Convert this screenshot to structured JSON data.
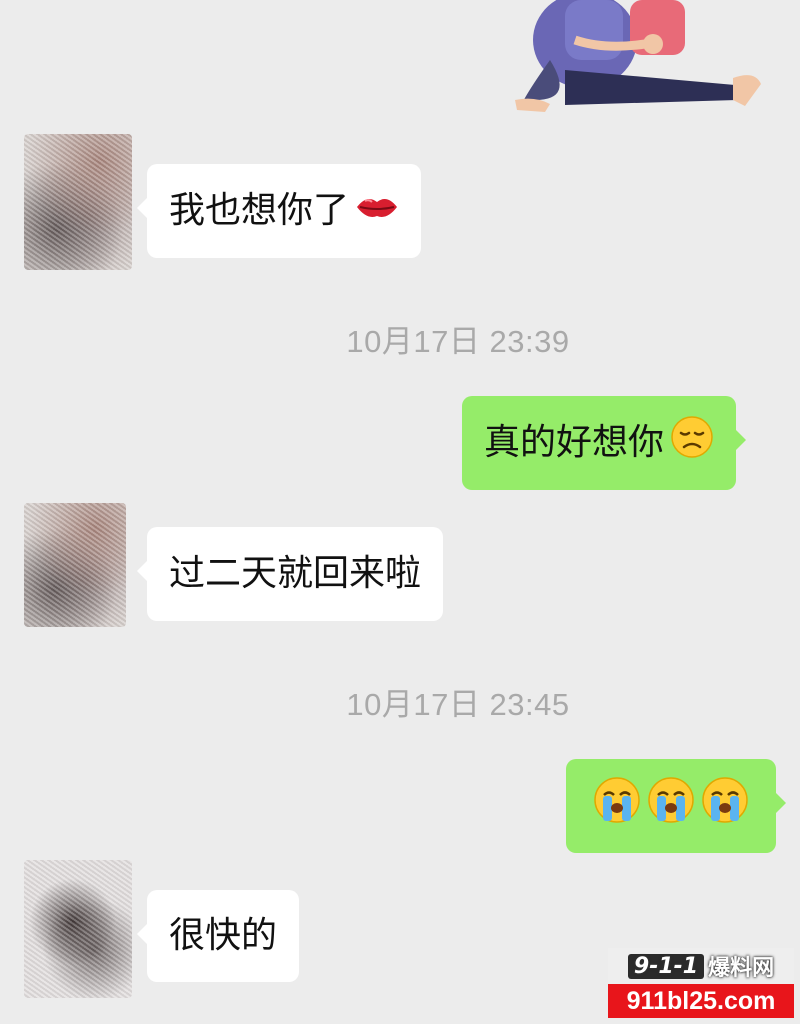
{
  "messages": [
    {
      "side": "left",
      "text": "我也想你了",
      "emoji": "kiss-mark"
    },
    {
      "side": "right",
      "text": "真的好想你",
      "emoji": "disappointed-face"
    },
    {
      "side": "left",
      "text": "过二天就回来啦"
    },
    {
      "side": "right",
      "text": "",
      "emoji": "loudly-crying-face x3"
    },
    {
      "side": "left",
      "text": "很快的"
    }
  ],
  "timestamps": [
    "10月17日 23:39",
    "10月17日 23:45"
  ],
  "watermark": {
    "badge": "9-1-1",
    "name": "爆料网",
    "url": "911bl25.com"
  },
  "colors": {
    "background": "#ececec",
    "incoming_bubble": "#ffffff",
    "outgoing_bubble": "#95ec69",
    "timestamp": "#a9a9a9",
    "watermark_red": "#e8151b"
  }
}
